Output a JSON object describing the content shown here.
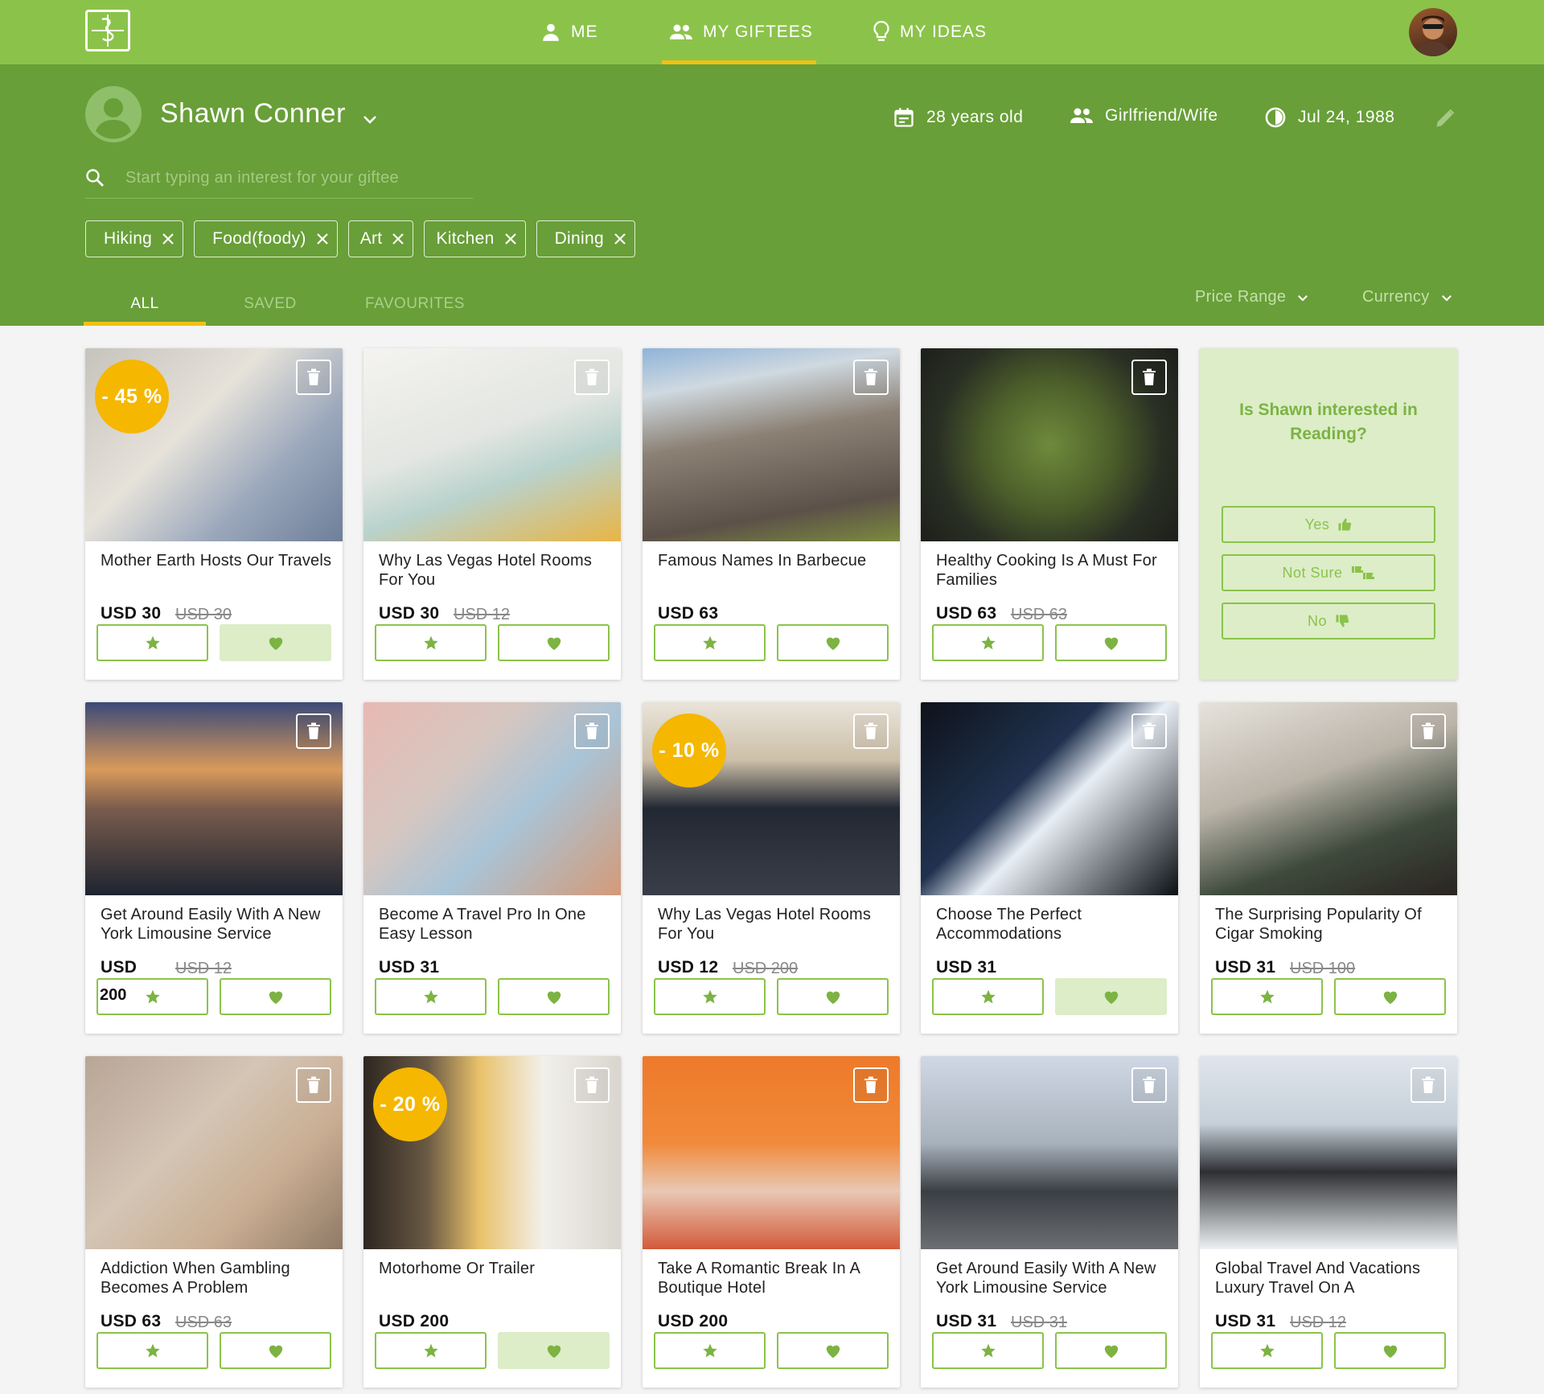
{
  "nav": {
    "items": [
      {
        "label": "ME"
      },
      {
        "label": "MY GIFTEES"
      },
      {
        "label": "MY IDEAS"
      }
    ]
  },
  "giftee": {
    "name": "Shawn Conner",
    "age": "28 years old",
    "relation": "Girlfriend/Wife",
    "birthday": "Jul 24, 1988"
  },
  "search": {
    "placeholder": "Start typing an interest for your giftee"
  },
  "interests": [
    "Hiking",
    "Food(foody)",
    "Art",
    "Kitchen",
    "Dining"
  ],
  "tabs": [
    {
      "label": "ALL"
    },
    {
      "label": "SAVED"
    },
    {
      "label": "FAVOURITES"
    }
  ],
  "filters": {
    "price_range": "Price Range",
    "currency": "Currency"
  },
  "question": {
    "text": "Is Shawn interested in Reading?",
    "yes": "Yes",
    "not_sure": "Not Sure",
    "no": "No"
  },
  "cards": [
    {
      "title": "Mother Earth Hosts Our Travels",
      "price": "USD 30",
      "old_price": "USD 30",
      "discount": "- 45 %",
      "favourited": true,
      "saved": false
    },
    {
      "title": "Why Las Vegas Hotel Rooms For You",
      "price": "USD 30",
      "old_price": "USD 12",
      "discount": "",
      "favourited": false,
      "saved": false
    },
    {
      "title": "Famous Names In Barbecue",
      "price": "USD 63",
      "old_price": "",
      "discount": "",
      "favourited": false,
      "saved": false
    },
    {
      "title": "Healthy Cooking Is A Must For Families",
      "price": "USD 63",
      "old_price": "USD 63",
      "discount": "",
      "favourited": false,
      "saved": false
    },
    {
      "title": "Get Around Easily With A New York Limousine Service",
      "price": "USD",
      "old_price": "USD 12",
      "discount": "",
      "favourited": false,
      "saved": false,
      "star_label": "200"
    },
    {
      "title": "Become A Travel Pro In One Easy Lesson",
      "price": "USD 31",
      "old_price": "",
      "discount": "",
      "favourited": false,
      "saved": false
    },
    {
      "title": "Why Las Vegas Hotel Rooms For You",
      "price": "USD 12",
      "old_price": "USD 200",
      "discount": "- 10 %",
      "favourited": false,
      "saved": false
    },
    {
      "title": "Choose The Perfect Accommodations",
      "price": "USD 31",
      "old_price": "",
      "discount": "",
      "favourited": true,
      "saved": false
    },
    {
      "title": "The Surprising Popularity Of Cigar Smoking",
      "price": "USD 31",
      "old_price": "USD 100",
      "discount": "",
      "favourited": false,
      "saved": false
    },
    {
      "title": "Addiction When Gambling Becomes A Problem",
      "price": "USD 63",
      "old_price": "USD 63",
      "discount": "",
      "favourited": false,
      "saved": false
    },
    {
      "title": "Motorhome Or Trailer",
      "price": "USD 200",
      "old_price": "",
      "discount": "- 20 %",
      "favourited": true,
      "saved": false
    },
    {
      "title": "Take A Romantic Break In A Boutique Hotel",
      "price": "USD 200",
      "old_price": "",
      "discount": "",
      "favourited": false,
      "saved": false
    },
    {
      "title": "Get Around Easily With A New York Limousine Service",
      "price": "USD 31",
      "old_price": "USD 31",
      "discount": "",
      "favourited": false,
      "saved": false
    },
    {
      "title": "Global Travel And Vacations Luxury Travel On A",
      "price": "USD 31",
      "old_price": "USD 12",
      "discount": "",
      "favourited": false,
      "saved": false
    }
  ],
  "colors": {
    "primary": "#8bc34a",
    "primary_dark": "#689f38",
    "accent": "#f2c014",
    "light": "#dcedc8"
  }
}
